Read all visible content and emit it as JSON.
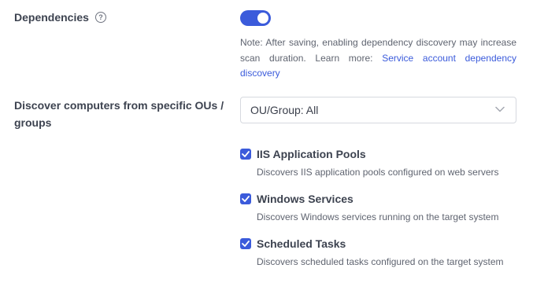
{
  "dependencies": {
    "label": "Dependencies",
    "help_icon": "?",
    "toggle_on": true,
    "note_prefix": "Note: After saving, enabling dependency discovery may increase scan duration. Learn more: ",
    "note_link": "Service account dependency discovery"
  },
  "ou": {
    "label": "Discover computers from specific OUs / groups",
    "select_value": "OU/Group: All",
    "chevron_icon": "chevron-down-icon"
  },
  "options": [
    {
      "label": "IIS Application Pools",
      "description": "Discovers IIS application pools configured on web servers",
      "checked": true
    },
    {
      "label": "Windows Services",
      "description": "Discovers Windows services running on the target system",
      "checked": true
    },
    {
      "label": "Scheduled Tasks",
      "description": "Discovers scheduled tasks configured on the target system",
      "checked": true
    }
  ],
  "colors": {
    "accent": "#3b5bdb",
    "text": "#3d4350",
    "muted": "#5f6470",
    "border": "#d6d9df"
  }
}
